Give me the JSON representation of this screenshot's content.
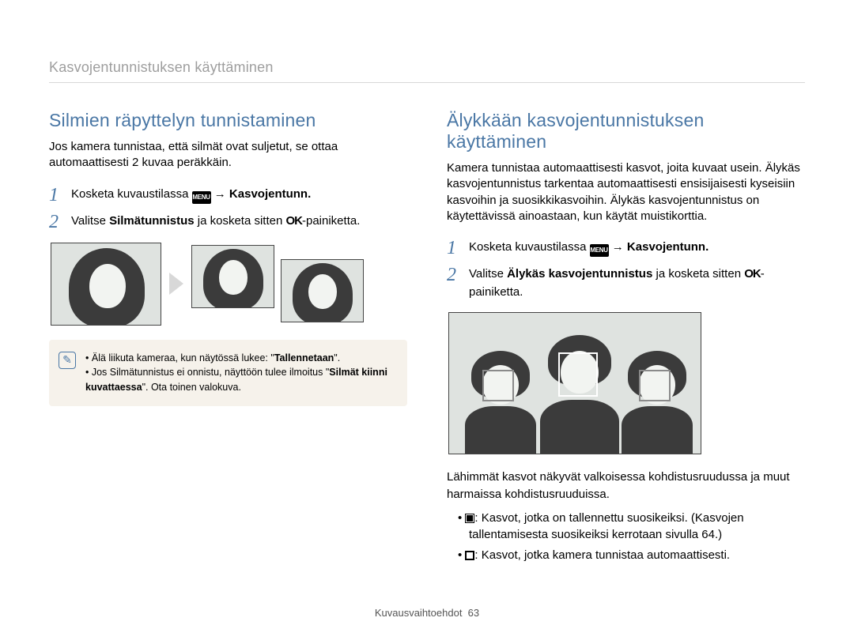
{
  "breadcrumb": "Kasvojentunnistuksen käyttäminen",
  "left": {
    "title": "Silmien räpyttelyn tunnistaminen",
    "intro": "Jos kamera tunnistaa, että silmät ovat suljetut, se ottaa automaattisesti 2 kuvaa peräkkäin.",
    "step1_pre": "Kosketa kuvaustilassa ",
    "menu_label": "MENU",
    "step1_arrow": " → ",
    "step1_bold": "Kasvojentunn.",
    "step2_a": "Valitse ",
    "step2_bold": "Silmätunnistus",
    "step2_b": " ja kosketa sitten ",
    "ok_glyph": "OK",
    "step2_c": "-painiketta.",
    "note1_a": "Älä liikuta kameraa, kun näytössä lukee: \"",
    "note1_quote": "Tallennetaan",
    "note1_b": "\".",
    "note2_a": "Jos Silmätunnistus ei onnistu, näyttöön tulee ilmoitus \"",
    "note2_quote": "Silmät kiinni kuvattaessa",
    "note2_b": "\". Ota toinen valokuva."
  },
  "right": {
    "title": "Älykkään kasvojentunnistuksen käyttäminen",
    "intro": "Kamera tunnistaa automaattisesti kasvot, joita kuvaat usein. Älykäs kasvojentunnistus tarkentaa automaattisesti ensisijaisesti kyseisiin kasvoihin ja suosikkikasvoihin. Älykäs kasvojentunnistus on käytettävissä ainoastaan, kun käytät muistikorttia.",
    "step1_pre": "Kosketa kuvaustilassa ",
    "step1_arrow": " → ",
    "step1_bold": "Kasvojentunn.",
    "step2_a": "Valitse ",
    "step2_bold": "Älykäs kasvojentunnistus",
    "step2_b": " ja kosketa sitten ",
    "step2_c": "-painiketta.",
    "after": "Lähimmät kasvot näkyvät valkoisessa kohdistusruudussa ja muut harmaissa kohdistusruuduissa.",
    "bullet1": ": Kasvot, jotka on tallennettu suosikeiksi. (Kasvojen tallentamisesta suosikeiksi kerrotaan sivulla 64.)",
    "bullet2": ": Kasvot, jotka kamera tunnistaa automaattisesti."
  },
  "footer_label": "Kuvausvaihtoehdot",
  "footer_page": "63"
}
